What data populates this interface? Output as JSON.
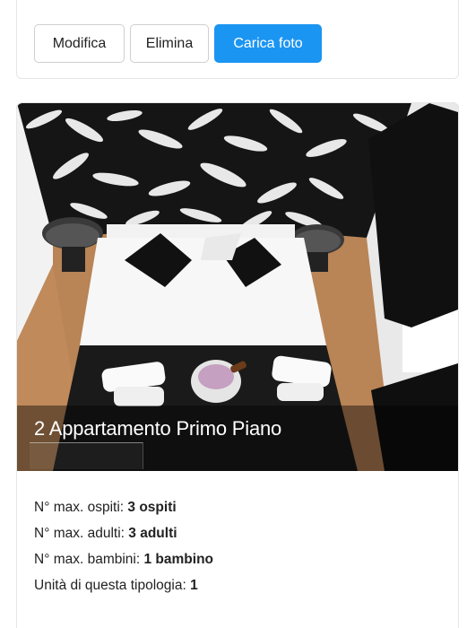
{
  "actions": {
    "edit_label": "Modifica",
    "delete_label": "Elimina",
    "upload_label": "Carica foto",
    "accent": "#1b95f2"
  },
  "room": {
    "title": "2 Appartamento Primo Piano",
    "photo_subject": "bedroom-photo",
    "details": [
      {
        "label": "N° max. ospiti:",
        "value": "3 ospiti"
      },
      {
        "label": "N° max. adulti:",
        "value": "3 adulti"
      },
      {
        "label": "N° max. bambini:",
        "value": "1 bambino"
      },
      {
        "label": "Unità di questa tipologia:",
        "value": "1"
      }
    ]
  }
}
